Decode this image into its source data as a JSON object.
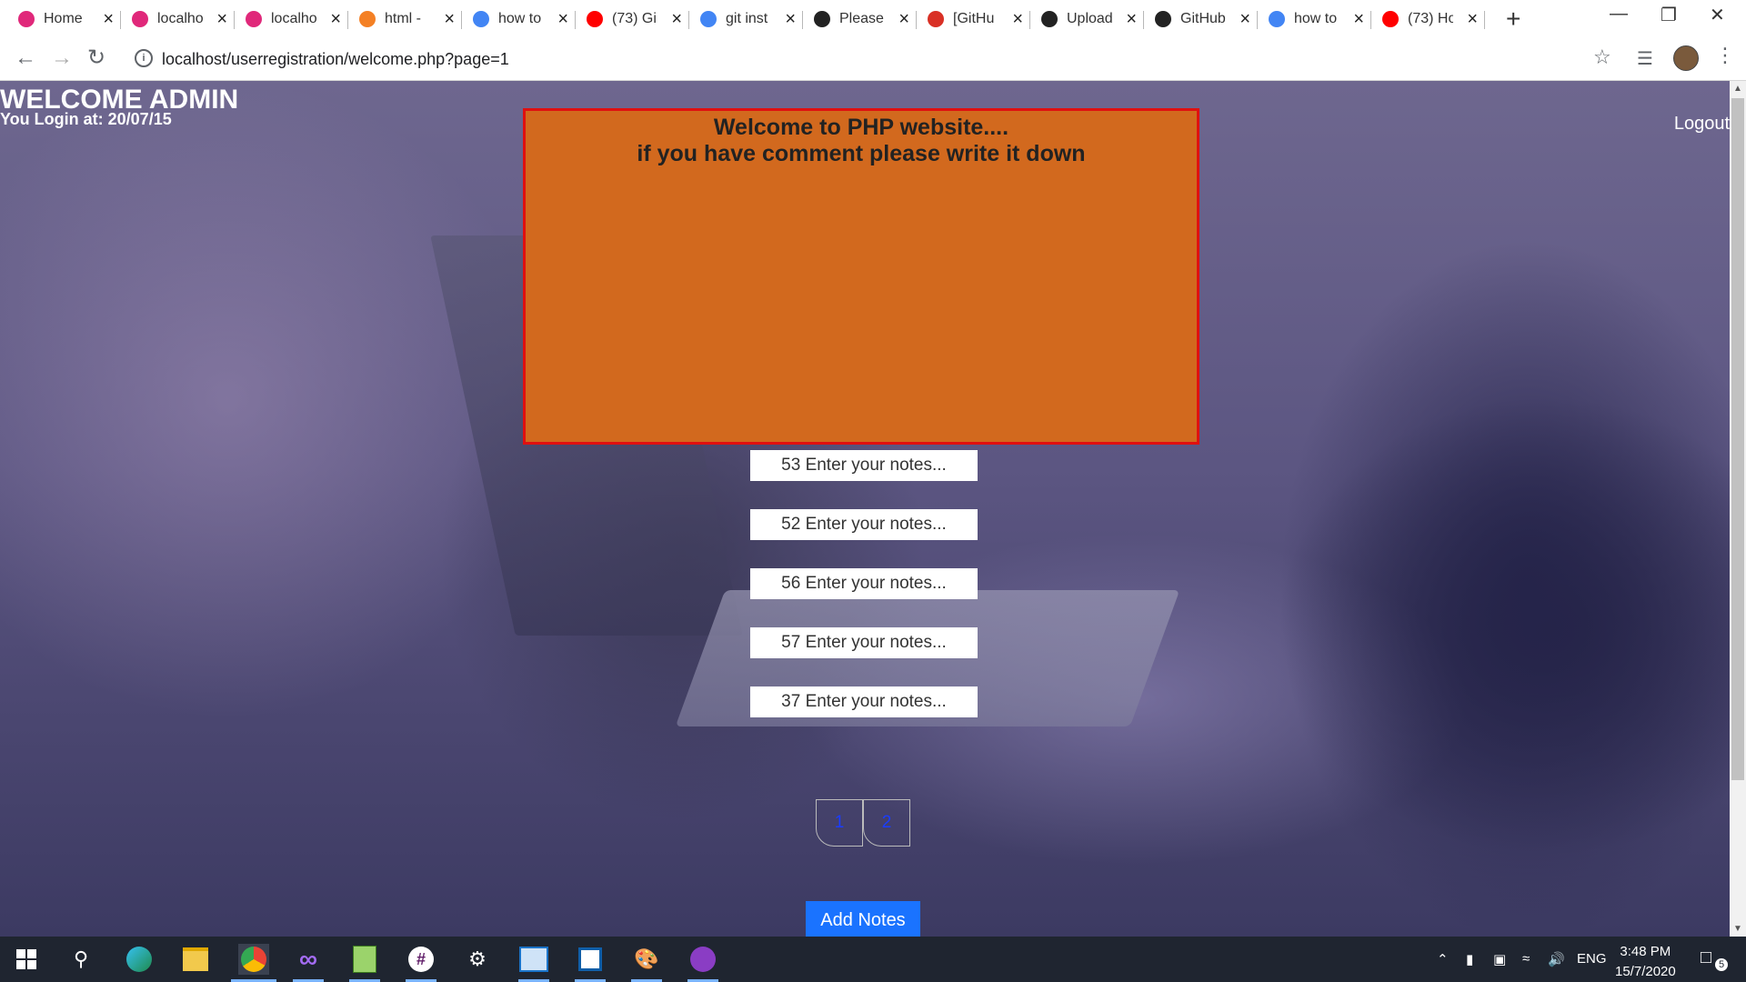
{
  "browser": {
    "tabs": [
      {
        "title": "Home",
        "icon": "wamp-icon",
        "color": "#e0287a",
        "active": true
      },
      {
        "title": "localhost",
        "icon": "wamp-icon",
        "color": "#e0287a"
      },
      {
        "title": "localhost",
        "icon": "wamp-icon",
        "color": "#e0287a"
      },
      {
        "title": "html - ",
        "icon": "stackoverflow-icon",
        "color": "#f48024"
      },
      {
        "title": "how to",
        "icon": "google-icon",
        "color": "#4285f4"
      },
      {
        "title": "(73) Gi",
        "icon": "youtube-icon",
        "color": "#ff0000"
      },
      {
        "title": "git inst",
        "icon": "google-icon",
        "color": "#4285f4"
      },
      {
        "title": "Please",
        "icon": "github-icon",
        "color": "#222222"
      },
      {
        "title": "[GitHu",
        "icon": "gmail-icon",
        "color": "#d93025"
      },
      {
        "title": "Upload",
        "icon": "github-icon",
        "color": "#222222"
      },
      {
        "title": "GitHub",
        "icon": "github-icon",
        "color": "#222222"
      },
      {
        "title": "how to",
        "icon": "google-icon",
        "color": "#4285f4"
      },
      {
        "title": "(73) Ho",
        "icon": "youtube-icon",
        "color": "#ff0000"
      }
    ],
    "new_tab": "+",
    "url": "localhost/userregistration/welcome.php?page=1"
  },
  "page": {
    "welcome_title": "WELCOME ADMIN",
    "login_time": "You Login at: 20/07/15",
    "logout": "Logout",
    "comment_box": {
      "line1": "Welcome to PHP website....",
      "line2": "if you have comment please write it down",
      "background": "#d2691e",
      "border_color": "#e01010"
    },
    "notes": [
      "53 Enter your notes...",
      "52 Enter your notes...",
      "56 Enter your notes...",
      "57 Enter your notes...",
      "37 Enter your notes..."
    ],
    "pagination": [
      "1",
      "2"
    ],
    "add_notes": "Add Notes"
  },
  "taskbar": {
    "apps": [
      "start-icon",
      "search-icon",
      "edge-icon",
      "file-explorer-icon",
      "chrome-icon",
      "visual-studio-icon",
      "notepad-plus-icon",
      "slack-icon",
      "settings-icon",
      "outlook-icon",
      "app-icon",
      "paint-icon",
      "github-desktop-icon"
    ],
    "language": "ENG",
    "time": "3:48 PM",
    "date": "15/7/2020",
    "notification_count": "5"
  }
}
